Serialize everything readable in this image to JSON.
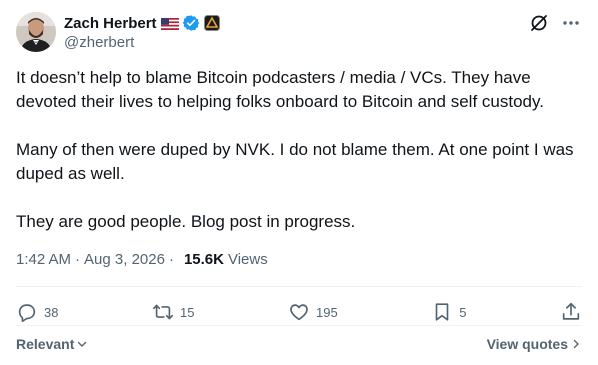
{
  "author": {
    "display_name": "Zach Herbert",
    "handle": "@zherbert"
  },
  "post": {
    "text": "It doesn’t help to blame Bitcoin podcasters / media / VCs. They have devoted their lives to helping folks onboard to Bitcoin and self custody.\n\nMany of then were duped by NVK. I do not blame them. At one point I was duped as well.\n\nThey are good people. Blog post in progress.",
    "time": "1:42 AM",
    "separator": "·",
    "date": "Aug 3, 2026",
    "views_count": "15.6K",
    "views_label": "Views"
  },
  "actions": {
    "replies": "38",
    "reposts": "15",
    "likes": "195",
    "bookmarks": "5"
  },
  "footer": {
    "sort_label": "Relevant",
    "quotes_label": "View quotes"
  },
  "icons": {
    "verified": "verified-badge-icon",
    "flag": "us-flag-icon",
    "affiliation": "affiliation-badge-icon",
    "grok": "grok-icon",
    "more": "more-icon",
    "reply": "reply-icon",
    "repost": "repost-icon",
    "like": "heart-icon",
    "bookmark": "bookmark-icon",
    "share": "share-icon"
  },
  "colors": {
    "text": "#0f1419",
    "secondary": "#536471",
    "verified": "#1d9bf0",
    "divider": "#eff3f4"
  }
}
